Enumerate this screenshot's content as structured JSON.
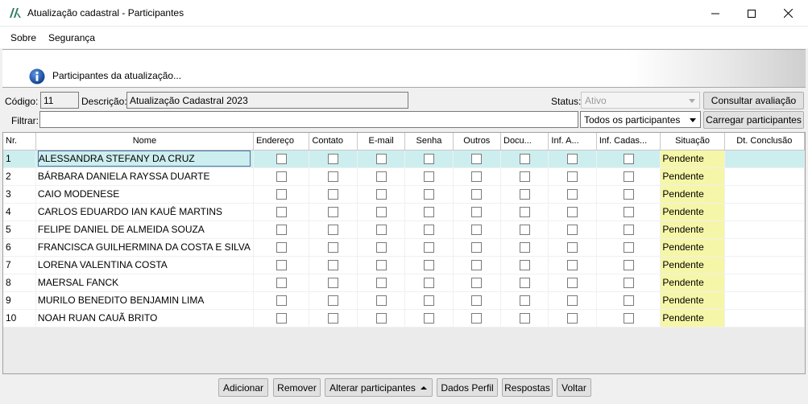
{
  "window": {
    "title": "Atualização cadastral - Participantes"
  },
  "menu": [
    {
      "label": "Sobre"
    },
    {
      "label": "Segurança"
    }
  ],
  "header": {
    "text": "Participantes da atualização..."
  },
  "form": {
    "codigo_label": "Código:",
    "codigo_value": "11",
    "descricao_label": "Descrição:",
    "descricao_value": "Atualização Cadastral 2023",
    "status_label": "Status:",
    "status_value": "Ativo",
    "consultar_label": "Consultar avaliação",
    "filtrar_label": "Filtrar:",
    "filtrar_value": "",
    "participantes_filter": "Todos os participantes",
    "carregar_label": "Carregar participantes"
  },
  "table": {
    "columns": [
      "Nr.",
      "Nome",
      "Endereço",
      "Contato",
      "E-mail",
      "Senha",
      "Outros",
      "Docu...",
      "Inf. A...",
      "Inf. Cadas...",
      "Situação",
      "Dt. Conclusão"
    ],
    "rows": [
      {
        "nr": "1",
        "nome": "ALESSANDRA STEFANY DA CRUZ",
        "situacao": "Pendente",
        "dt": ""
      },
      {
        "nr": "2",
        "nome": "BÁRBARA DANIELA RAYSSA DUARTE",
        "situacao": "Pendente",
        "dt": ""
      },
      {
        "nr": "3",
        "nome": "CAIO MODENESE",
        "situacao": "Pendente",
        "dt": ""
      },
      {
        "nr": "4",
        "nome": "CARLOS EDUARDO IAN KAUÊ MARTINS",
        "situacao": "Pendente",
        "dt": ""
      },
      {
        "nr": "5",
        "nome": "FELIPE DANIEL DE ALMEIDA SOUZA",
        "situacao": "Pendente",
        "dt": ""
      },
      {
        "nr": "6",
        "nome": "FRANCISCA GUILHERMINA DA COSTA E SILVA",
        "situacao": "Pendente",
        "dt": ""
      },
      {
        "nr": "7",
        "nome": "LORENA VALENTINA COSTA",
        "situacao": "Pendente",
        "dt": ""
      },
      {
        "nr": "8",
        "nome": "MAERSAL FANCK",
        "situacao": "Pendente",
        "dt": ""
      },
      {
        "nr": "9",
        "nome": "MURILO BENEDITO BENJAMIN LIMA",
        "situacao": "Pendente",
        "dt": ""
      },
      {
        "nr": "10",
        "nome": "NOAH RUAN CAUÃ BRITO",
        "situacao": "Pendente",
        "dt": ""
      }
    ]
  },
  "buttons": {
    "adicionar": "Adicionar",
    "remover": "Remover",
    "alterar": "Alterar participantes",
    "dados_perfil": "Dados Perfil",
    "respostas": "Respostas",
    "voltar": "Voltar"
  },
  "colors": {
    "selected_row": "#cdeeee",
    "status_pending": "#f6f6a8",
    "info_blue": "#1c5bb8"
  }
}
